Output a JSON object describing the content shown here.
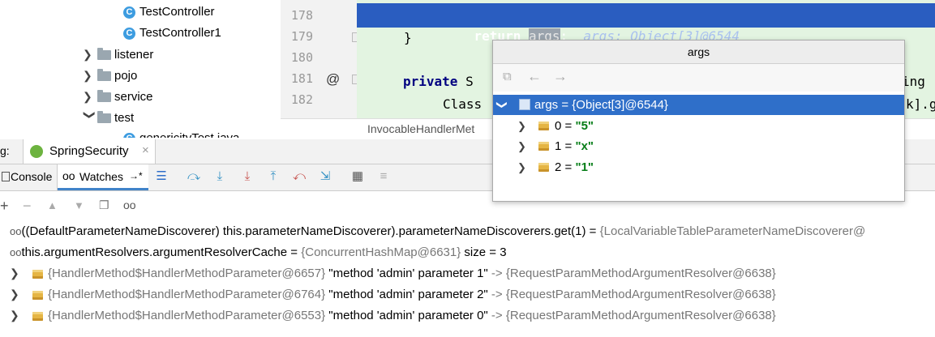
{
  "tree": {
    "items": [
      {
        "label": "TestController",
        "type": "class"
      },
      {
        "label": "TestController1",
        "type": "class"
      },
      {
        "label": "listener",
        "type": "folder"
      },
      {
        "label": "pojo",
        "type": "folder"
      },
      {
        "label": "service",
        "type": "folder"
      },
      {
        "label": "test",
        "type": "folder"
      },
      {
        "label": "genericityTest.java",
        "type": "class"
      }
    ]
  },
  "editor": {
    "line_numbers": [
      "178",
      "179",
      "180",
      "181",
      "182"
    ],
    "annotation_marker": "@",
    "lines": {
      "l178_kw": "return",
      "l178_var": "args",
      "l178_semi": ";",
      "l178_hint": "args: Object[3]@6544",
      "l179": "}",
      "l181_kw": "private",
      "l181_rest": " S",
      "l181_tail": "ing",
      "l182": "Class",
      "l182_tail": "k].g"
    },
    "breadcrumb": "InvocableHandlerMet"
  },
  "debug": {
    "tab_prefix": "g:",
    "config_name": "SpringSecurity",
    "console_label": "Console",
    "watches_label": "Watches",
    "watches_arrow": "→*"
  },
  "popup": {
    "title": "args",
    "root": "args = {Object[3]@6544}",
    "items": [
      {
        "index": "0",
        "value": "\"5\""
      },
      {
        "index": "1",
        "value": "\"x\""
      },
      {
        "index": "2",
        "value": "\"1\""
      }
    ]
  },
  "watches": {
    "rows": [
      {
        "expr": "((DefaultParameterNameDiscoverer) this.parameterNameDiscoverer).parameterNameDiscoverers.get(1)",
        "eq": " = ",
        "value": "{LocalVariableTableParameterNameDiscoverer@"
      },
      {
        "expr": "this.argumentResolvers.argumentResolverCache",
        "eq": " = ",
        "value": "{ConcurrentHashMap@6631}",
        "extra": "size = 3"
      }
    ],
    "entries": [
      {
        "key": "{HandlerMethod$HandlerMethodParameter@6657}",
        "name": "\"method 'admin' parameter 1\"",
        "arrow": " -> ",
        "resolver": "{RequestParamMethodArgumentResolver@6638}"
      },
      {
        "key": "{HandlerMethod$HandlerMethodParameter@6764}",
        "name": "\"method 'admin' parameter 2\"",
        "arrow": " -> ",
        "resolver": "{RequestParamMethodArgumentResolver@6638}"
      },
      {
        "key": "{HandlerMethod$HandlerMethodParameter@6553}",
        "name": "\"method 'admin' parameter 0\"",
        "arrow": " -> ",
        "resolver": "{RequestParamMethodArgumentResolver@6638}"
      }
    ]
  },
  "colors": {
    "selection": "#2a5dc0",
    "code_bg": "#e3f4e1",
    "popup_selection": "#2f6fc9",
    "string_green": "#067d17"
  }
}
